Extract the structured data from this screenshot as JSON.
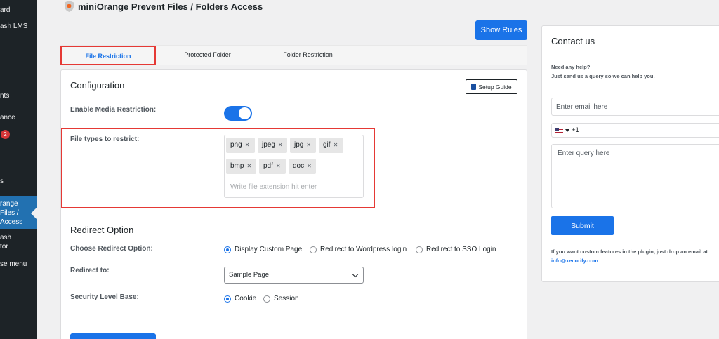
{
  "sidebar": {
    "items": [
      {
        "label": "ard"
      },
      {
        "label": "ash LMS"
      },
      {
        "label": "nts"
      },
      {
        "label": "ance"
      },
      {
        "label": "s"
      },
      {
        "label": "ash"
      },
      {
        "label": "tor"
      },
      {
        "label": "se menu"
      }
    ],
    "badge": "2",
    "active_item": [
      "range",
      "Files /",
      "Access"
    ]
  },
  "header": {
    "title": "miniOrange Prevent Files / Folders Access",
    "show_rules_label": "Show Rules"
  },
  "tabs": [
    {
      "label": "File Restriction",
      "active": true
    },
    {
      "label": "Protected Folder",
      "active": false
    },
    {
      "label": "Folder Restriction",
      "active": false
    }
  ],
  "configuration": {
    "title": "Configuration",
    "setup_guide_label": "Setup Guide",
    "enable_media_label": "Enable Media Restriction:",
    "enable_media_on": true,
    "file_types_label": "File types to restrict:",
    "file_types": [
      "png",
      "jpeg",
      "jpg",
      "gif",
      "bmp",
      "pdf",
      "doc"
    ],
    "file_type_placeholder": "Write file extension hit enter"
  },
  "redirect": {
    "title": "Redirect Option",
    "choose_label": "Choose Redirect Option:",
    "options": [
      {
        "label": "Display Custom Page",
        "checked": true
      },
      {
        "label": "Redirect to Wordpress login",
        "checked": false
      },
      {
        "label": "Redirect to SSO Login",
        "checked": false
      }
    ],
    "redirect_to_label": "Redirect to:",
    "redirect_to_value": "Sample Page",
    "security_label": "Security Level Base:",
    "security_options": [
      {
        "label": "Cookie",
        "checked": true
      },
      {
        "label": "Session",
        "checked": false
      }
    ]
  },
  "contact": {
    "title": "Contact us",
    "help_line1": "Need any help?",
    "help_line2": "Just send us a query so we can help you.",
    "email_placeholder": "Enter email here",
    "phone_code": "+1",
    "query_placeholder": "Enter query here",
    "submit_label": "Submit",
    "note": "If you want custom features in the plugin, just drop an email at",
    "email": "info@xecurify.com"
  },
  "colors": {
    "primary": "#1a73e8",
    "highlight": "#e53935",
    "sidebar_bg": "#1d2327",
    "sidebar_active": "#2271b1"
  }
}
